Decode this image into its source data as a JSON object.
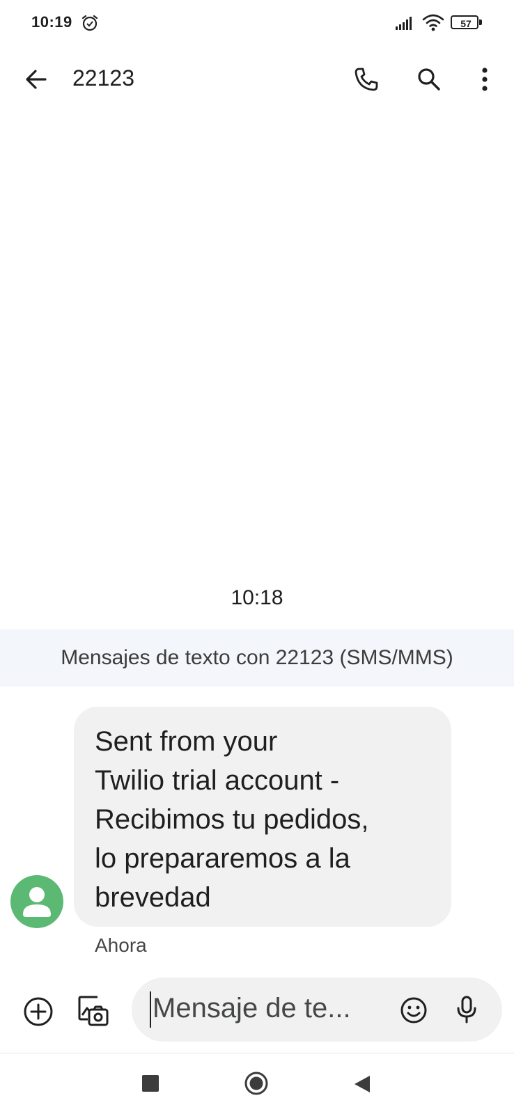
{
  "status_bar": {
    "time": "10:19",
    "battery_level": "57",
    "icons": [
      "alarm-icon",
      "signal-icon",
      "wifi-icon",
      "battery-icon"
    ]
  },
  "app_bar": {
    "title": "22123",
    "icons": [
      "back-arrow-icon",
      "phone-icon",
      "search-icon",
      "more-vert-icon"
    ]
  },
  "conversation": {
    "timestamp": "10:18",
    "banner": "Mensajes de texto con 22123 (SMS/MMS)",
    "messages": [
      {
        "text": "Sent from your\nTwilio trial account -\nRecibimos tu pedidos,\nlo prepararemos a la\nbrevedad",
        "time": "Ahora"
      }
    ]
  },
  "compose": {
    "placeholder": "Mensaje de te...",
    "icons": [
      "add-circle-icon",
      "gallery-camera-icon",
      "emoji-icon",
      "mic-icon"
    ]
  },
  "nav_bar": {
    "icons": [
      "recents-icon",
      "home-icon",
      "back-triangle-icon"
    ]
  },
  "colors": {
    "avatar": "#5bb974",
    "bubble": "#f1f1f1",
    "banner": "#f3f6fb",
    "text": "#1f1f1f"
  }
}
